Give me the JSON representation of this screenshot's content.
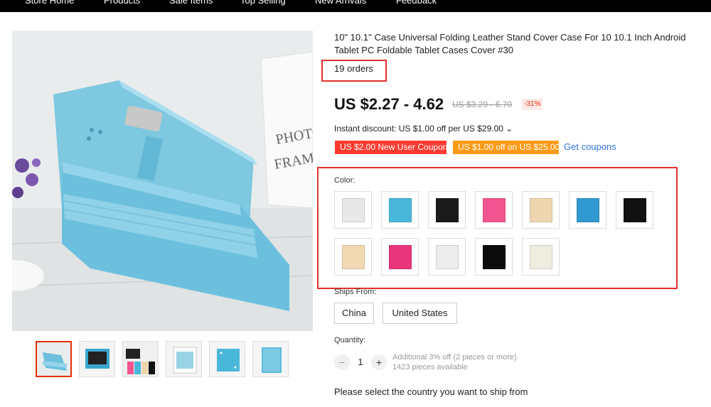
{
  "nav": [
    "Store Home",
    "Products",
    "Sale Items",
    "Top Selling",
    "New Arrivals",
    "Feedback"
  ],
  "product": {
    "title": "10\" 10.1'' Case Universal Folding Leather Stand Cover Case For 10 10.1 Inch Android Tablet PC Foldable Tablet Cases Cover #30",
    "orders": "19 orders",
    "price": "US $2.27 - 4.62",
    "original_price": "US $3.29 - 6.70",
    "discount": "-31%",
    "instant_discount": "Instant discount: US $1.00 off per US $29.00 ⌄",
    "coupons": [
      "US $2.00 New User Coupon",
      "US $1.00 off on US $25.00"
    ],
    "get_coupons": "Get coupons"
  },
  "gallery": {
    "main_image": "tablet-case-blue-photo",
    "thumbnails": [
      "blue-case",
      "blue-case-open",
      "multi-color-cases",
      "white-case",
      "blue-case-front",
      "blue-case-back"
    ]
  },
  "color": {
    "label": "Color:",
    "swatches": [
      "#e8e8e8",
      "#49b7d8",
      "#1a1a1a",
      "#f2558f",
      "#efd6b0",
      "#3199d2",
      "#111111",
      "#f0d9b3",
      "#e8357a",
      "#ececec",
      "#0b0b0b",
      "#efece0"
    ]
  },
  "ships_from": {
    "label": "Ships From:",
    "options": [
      "China",
      "United States"
    ]
  },
  "quantity": {
    "label": "Quantity:",
    "value": "1",
    "minus": "−",
    "plus": "+",
    "note_discount": "Additional 3% off (2 pieces or more)",
    "note_available": "1423 pieces available"
  },
  "ship_note": "Please select the country you want to ship from",
  "colors": {
    "price_red": "#e62e04",
    "link_blue": "#2f73d8",
    "highlight": "#e5302f",
    "coupon_red": "#ff3b30",
    "coupon_orange": "#ff9a16"
  }
}
